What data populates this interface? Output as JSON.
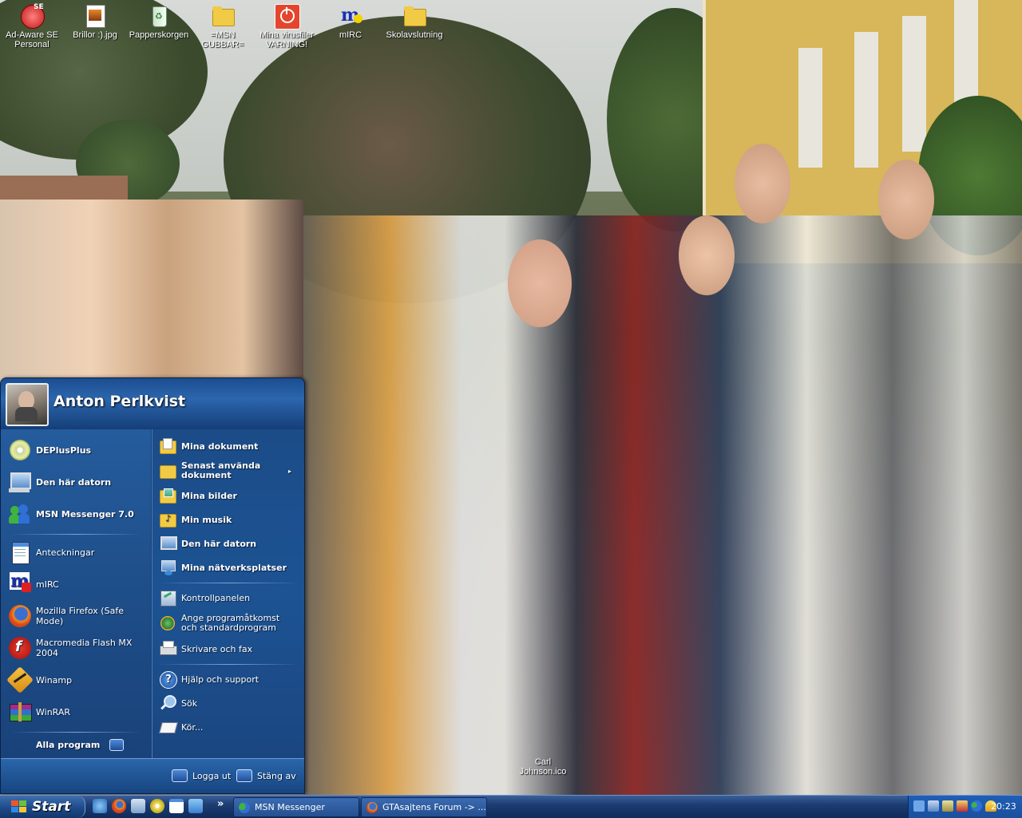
{
  "desktop": {
    "icons": [
      {
        "label": "Ad-Aware SE Personal",
        "icon": "ad-aware-icon"
      },
      {
        "label": "Brillor :).jpg",
        "icon": "image-file-icon"
      },
      {
        "label": "Papperskorgen",
        "icon": "recycle-bin-icon"
      },
      {
        "label": "=MSN GUBBAR=",
        "icon": "folder-icon"
      },
      {
        "label": "Mina virusfiler VARNING!",
        "icon": "virus-folder-icon"
      },
      {
        "label": "mIRC",
        "icon": "mirc-icon"
      },
      {
        "label": "Skolavslutning",
        "icon": "folder-icon"
      }
    ],
    "floating_icon": {
      "label": "Carl Johnson.ico"
    }
  },
  "start_menu": {
    "user_name": "Anton Perlkvist",
    "pinned": [
      {
        "label": "DEPlusPlus",
        "icon": "cd-icon"
      },
      {
        "label": "Den här datorn",
        "icon": "computer-icon"
      },
      {
        "label": "MSN Messenger 7.0",
        "icon": "msn-icon"
      }
    ],
    "recent": [
      {
        "label": "Anteckningar",
        "icon": "notepad-icon"
      },
      {
        "label": "mIRC",
        "icon": "mirc-icon"
      },
      {
        "label": "Mozilla Firefox (Safe Mode)",
        "icon": "firefox-icon"
      },
      {
        "label": "Macromedia Flash MX 2004",
        "icon": "flash-icon"
      },
      {
        "label": "Winamp",
        "icon": "winamp-icon"
      },
      {
        "label": "WinRAR",
        "icon": "winrar-icon"
      }
    ],
    "all_programs": "Alla program",
    "right": {
      "group1": [
        {
          "label": "Mina dokument",
          "icon": "documents-folder-icon"
        },
        {
          "label": "Senast använda dokument",
          "icon": "recent-folder-icon",
          "submenu": true
        },
        {
          "label": "Mina bilder",
          "icon": "pictures-folder-icon"
        },
        {
          "label": "Min musik",
          "icon": "music-folder-icon"
        },
        {
          "label": "Den här datorn",
          "icon": "computer-icon"
        },
        {
          "label": "Mina nätverksplatser",
          "icon": "network-icon"
        }
      ],
      "group2": [
        {
          "label": "Kontrollpanelen",
          "icon": "control-panel-icon"
        },
        {
          "label": "Ange programåtkomst och standardprogram",
          "icon": "program-access-icon"
        },
        {
          "label": "Skrivare och fax",
          "icon": "printer-icon"
        }
      ],
      "group3": [
        {
          "label": "Hjälp och support",
          "icon": "help-icon"
        },
        {
          "label": "Sök",
          "icon": "search-icon"
        },
        {
          "label": "Kör...",
          "icon": "run-icon"
        }
      ]
    },
    "footer": {
      "logoff": "Logga ut",
      "shutdown": "Stäng av"
    }
  },
  "taskbar": {
    "start_label": "Start",
    "chevron": "»",
    "buttons": [
      {
        "label": "MSN Messenger",
        "icon": "msn-icon"
      },
      {
        "label": "GTAsajtens Forum -> ...",
        "icon": "firefox-icon"
      }
    ],
    "clock": "20:23"
  },
  "colors": {
    "menu_blue": "#1d4b85",
    "taskbar_blue": "#1d3d73",
    "folder_yellow": "#f2cb46"
  }
}
